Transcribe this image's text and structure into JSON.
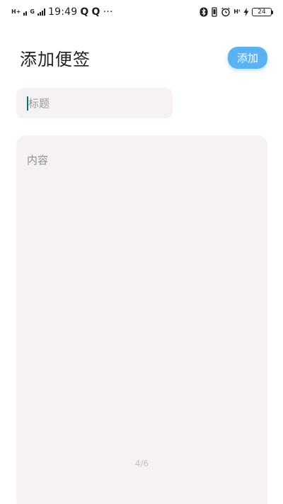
{
  "status_bar": {
    "network_left_1": "H+",
    "network_left_2": "G",
    "time": "19:49",
    "app_icon_1": "Q",
    "app_icon_2": "Q",
    "more": "···",
    "network_right": "Hᵗ",
    "battery_level": "24"
  },
  "header": {
    "title": "添加便签",
    "add_button_label": "添加"
  },
  "title_input": {
    "placeholder": "标题",
    "value": ""
  },
  "content_input": {
    "placeholder": "内容",
    "value": ""
  },
  "page_indicator": "4/6",
  "colors": {
    "accent": "#5ab2f0",
    "field_bg": "#f6f1f5",
    "caret": "#00796b"
  }
}
